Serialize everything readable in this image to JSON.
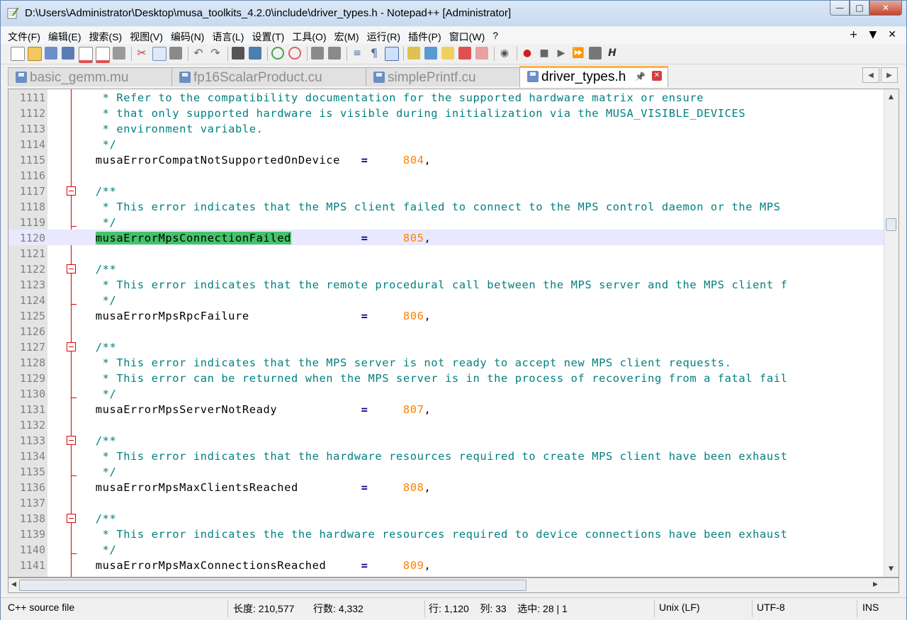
{
  "window": {
    "title": "D:\\Users\\Administrator\\Desktop\\musa_toolkits_4.2.0\\include\\driver_types.h - Notepad++ [Administrator]",
    "controls": {
      "minimize": "—",
      "maximize": "□",
      "close": "✕"
    }
  },
  "menu": {
    "items": [
      "文件(F)",
      "编辑(E)",
      "搜索(S)",
      "视图(V)",
      "编码(N)",
      "语言(L)",
      "设置(T)",
      "工具(O)",
      "宏(M)",
      "运行(R)",
      "插件(P)",
      "窗口(W)",
      "?"
    ],
    "right": [
      "+",
      "▼",
      "✕"
    ]
  },
  "tabs": [
    {
      "label": "basic_gemm.mu",
      "active": false
    },
    {
      "label": "fp16ScalarProduct.cu",
      "active": false
    },
    {
      "label": "simplePrintf.cu",
      "active": false
    },
    {
      "label": "driver_types.h",
      "active": true,
      "pin": "📌",
      "close": "✕"
    }
  ],
  "tab_nav": {
    "left": "◀",
    "right": "▶"
  },
  "editor": {
    "lines": [
      {
        "n": "1111",
        "parts": [
          {
            "c": "cmt",
            "t": "   * Refer to the compatibility documentation for the supported hardware matrix or ensure"
          }
        ]
      },
      {
        "n": "1112",
        "parts": [
          {
            "c": "cmt",
            "t": "   * that only supported hardware is visible during initialization via the MUSA_VISIBLE_DEVICES"
          }
        ]
      },
      {
        "n": "1113",
        "parts": [
          {
            "c": "cmt",
            "t": "   * environment variable."
          }
        ]
      },
      {
        "n": "1114",
        "parts": [
          {
            "c": "cmt",
            "t": "   */"
          }
        ]
      },
      {
        "n": "1115",
        "parts": [
          {
            "c": "ident",
            "t": "  musaErrorCompatNotSupportedOnDevice   "
          },
          {
            "c": "op",
            "t": "="
          },
          {
            "c": "ident",
            "t": "     "
          },
          {
            "c": "num",
            "t": "804"
          },
          {
            "c": "ident",
            "t": ","
          }
        ]
      },
      {
        "n": "1116",
        "parts": []
      },
      {
        "n": "1117",
        "parts": [
          {
            "c": "cmt",
            "t": "  /**"
          }
        ],
        "fold": "start"
      },
      {
        "n": "1118",
        "parts": [
          {
            "c": "cmt",
            "t": "   * This error indicates that the MPS client failed to connect to the MPS control daemon or the MPS"
          }
        ]
      },
      {
        "n": "1119",
        "parts": [
          {
            "c": "cmt",
            "t": "   */"
          }
        ],
        "fold": "end"
      },
      {
        "n": "1120",
        "parts": [
          {
            "c": "ident",
            "t": "  "
          },
          {
            "c": "hl",
            "t": "musaErrorMpsConnectionFailed"
          },
          {
            "c": "ident",
            "t": "          "
          },
          {
            "c": "op",
            "t": "="
          },
          {
            "c": "ident",
            "t": "     "
          },
          {
            "c": "num",
            "t": "805"
          },
          {
            "c": "ident",
            "t": ","
          }
        ],
        "current": true
      },
      {
        "n": "1121",
        "parts": []
      },
      {
        "n": "1122",
        "parts": [
          {
            "c": "cmt",
            "t": "  /**"
          }
        ],
        "fold": "start"
      },
      {
        "n": "1123",
        "parts": [
          {
            "c": "cmt",
            "t": "   * This error indicates that the remote procedural call between the MPS server and the MPS client f"
          }
        ]
      },
      {
        "n": "1124",
        "parts": [
          {
            "c": "cmt",
            "t": "   */"
          }
        ],
        "fold": "end"
      },
      {
        "n": "1125",
        "parts": [
          {
            "c": "ident",
            "t": "  musaErrorMpsRpcFailure                "
          },
          {
            "c": "op",
            "t": "="
          },
          {
            "c": "ident",
            "t": "     "
          },
          {
            "c": "num",
            "t": "806"
          },
          {
            "c": "ident",
            "t": ","
          }
        ]
      },
      {
        "n": "1126",
        "parts": []
      },
      {
        "n": "1127",
        "parts": [
          {
            "c": "cmt",
            "t": "  /**"
          }
        ],
        "fold": "start"
      },
      {
        "n": "1128",
        "parts": [
          {
            "c": "cmt",
            "t": "   * This error indicates that the MPS server is not ready to accept new MPS client requests."
          }
        ]
      },
      {
        "n": "1129",
        "parts": [
          {
            "c": "cmt",
            "t": "   * This error can be returned when the MPS server is in the process of recovering from a fatal fail"
          }
        ]
      },
      {
        "n": "1130",
        "parts": [
          {
            "c": "cmt",
            "t": "   */"
          }
        ],
        "fold": "end"
      },
      {
        "n": "1131",
        "parts": [
          {
            "c": "ident",
            "t": "  musaErrorMpsServerNotReady            "
          },
          {
            "c": "op",
            "t": "="
          },
          {
            "c": "ident",
            "t": "     "
          },
          {
            "c": "num",
            "t": "807"
          },
          {
            "c": "ident",
            "t": ","
          }
        ]
      },
      {
        "n": "1132",
        "parts": []
      },
      {
        "n": "1133",
        "parts": [
          {
            "c": "cmt",
            "t": "  /**"
          }
        ],
        "fold": "start"
      },
      {
        "n": "1134",
        "parts": [
          {
            "c": "cmt",
            "t": "   * This error indicates that the hardware resources required to create MPS client have been exhaust"
          }
        ]
      },
      {
        "n": "1135",
        "parts": [
          {
            "c": "cmt",
            "t": "   */"
          }
        ],
        "fold": "end"
      },
      {
        "n": "1136",
        "parts": [
          {
            "c": "ident",
            "t": "  musaErrorMpsMaxClientsReached         "
          },
          {
            "c": "op",
            "t": "="
          },
          {
            "c": "ident",
            "t": "     "
          },
          {
            "c": "num",
            "t": "808"
          },
          {
            "c": "ident",
            "t": ","
          }
        ]
      },
      {
        "n": "1137",
        "parts": []
      },
      {
        "n": "1138",
        "parts": [
          {
            "c": "cmt",
            "t": "  /**"
          }
        ],
        "fold": "start"
      },
      {
        "n": "1139",
        "parts": [
          {
            "c": "cmt",
            "t": "   * This error indicates the the hardware resources required to device connections have been exhaust"
          }
        ]
      },
      {
        "n": "1140",
        "parts": [
          {
            "c": "cmt",
            "t": "   */"
          }
        ],
        "fold": "end"
      },
      {
        "n": "1141",
        "parts": [
          {
            "c": "ident",
            "t": "  musaErrorMpsMaxConnectionsReached     "
          },
          {
            "c": "op",
            "t": "="
          },
          {
            "c": "ident",
            "t": "     "
          },
          {
            "c": "num",
            "t": "809"
          },
          {
            "c": "ident",
            "t": ","
          }
        ]
      }
    ]
  },
  "status": {
    "language": "C++ source file",
    "length": "长度: 210,577",
    "lines": "行数: 4,332",
    "position": "行: 1,120    列: 33    选中: 28 | 1",
    "eol": "Unix (LF)",
    "encoding": "UTF-8",
    "mode": "INS"
  },
  "colors": {
    "comment": "#008080",
    "number": "#ff8000",
    "operator": "#000080",
    "highlight": "#44c36a",
    "current_line": "#e8e8ff",
    "fold_marker": "#e00000",
    "active_tab_accent": "#fdb04a"
  }
}
